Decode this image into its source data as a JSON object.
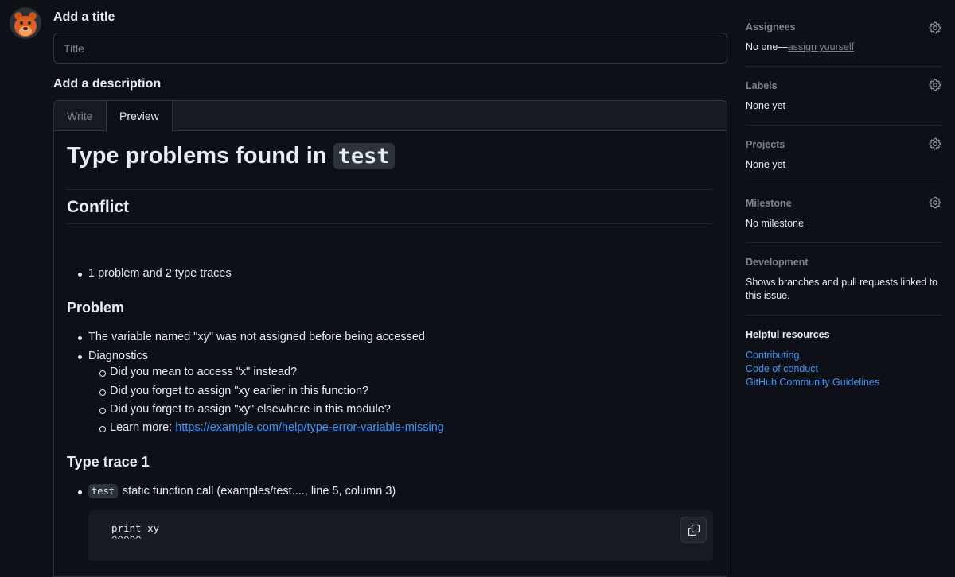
{
  "form": {
    "title_label": "Add a title",
    "title_placeholder": "Title",
    "description_label": "Add a description"
  },
  "editor": {
    "tabs": [
      "Write",
      "Preview"
    ],
    "active_tab": "Preview"
  },
  "preview": {
    "h1_text": "Type problems found in ",
    "h1_code": "test",
    "conflict_heading": "Conflict",
    "conflict_item": "1 problem and 2 type traces",
    "problem_heading": "Problem",
    "problem_items": [
      "The variable named \"xy\" was not assigned before being accessed",
      "Diagnostics"
    ],
    "diagnostics": [
      "Did you mean to access \"x\" instead?",
      "Did you forget to assign \"xy earlier in this function?",
      "Did you forget to assign \"xy\" elsewhere in this module?"
    ],
    "learn_more_label": "Learn more: ",
    "learn_more_url": "https://example.com/help/type-error-variable-missing",
    "trace_heading": "Type trace 1",
    "trace_code": "test",
    "trace_text": " static function call (examples/test...., line 5, column 3)",
    "code_line1": "print xy",
    "code_line2": "^^^^^"
  },
  "sidebar": {
    "assignees": {
      "title": "Assignees",
      "prefix": "No one—",
      "link": "assign yourself"
    },
    "labels": {
      "title": "Labels",
      "value": "None yet"
    },
    "projects": {
      "title": "Projects",
      "value": "None yet"
    },
    "milestone": {
      "title": "Milestone",
      "value": "No milestone"
    },
    "development": {
      "title": "Development",
      "line1": "Shows branches and pull requests linked to",
      "line2": "this issue."
    },
    "resources": {
      "title": "Helpful resources",
      "links": [
        "Contributing",
        "Code of conduct",
        "GitHub Community Guidelines"
      ]
    }
  },
  "colors": {
    "background": "#0d1117",
    "link": "#4493f8",
    "muted": "#7d8590",
    "border": "#30363d"
  }
}
